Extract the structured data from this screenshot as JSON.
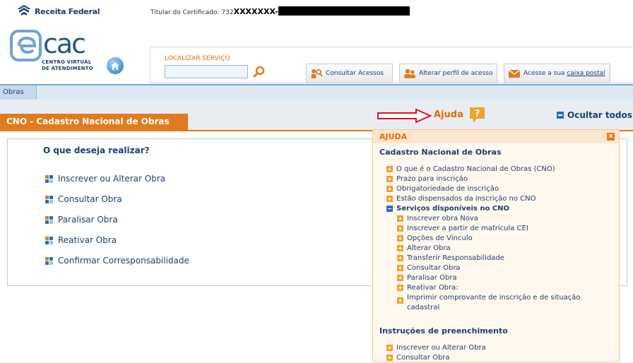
{
  "header": {
    "brand": "Receita Federal",
    "certificate_label": "Titular do Certificado: 732",
    "certificate_id": "XXXXXXX-",
    "logo_text": "cac",
    "logo_subtitle_1": "CENTRO VIRTUAL",
    "logo_subtitle_2": "DE ATENDIMENTO"
  },
  "search": {
    "label": "LOCALIZAR SERVIÇO",
    "value": ""
  },
  "toolbar": {
    "consultar_acessos": "Consultar Acessos",
    "alterar_perfil": "Alterar perfil de acesso",
    "caixa_prefix": "Acesse a sua ",
    "caixa_link": "caixa postal"
  },
  "nav": {
    "obras": "Obras"
  },
  "page": {
    "title": "CNO - Cadastro Nacional de Obras",
    "question": "O que deseja realizar?",
    "options": [
      "Inscrever ou Alterar Obra",
      "Consultar Obra",
      "Paralisar Obra",
      "Reativar Obra",
      "Confirmar Corresponsabilidade"
    ]
  },
  "help": {
    "link": "Ajuda",
    "hide_all": "Ocultar todos",
    "panel_title": "AJUDA",
    "close": "x",
    "section1": "Cadastro Nacional de Obras",
    "items": [
      "O que é o Cadastro Nacional de Obras (CNO)",
      "Prazo para inscrição",
      "Obrigatoriedade de inscrição",
      "Estão dispensados da inscrição no CNO"
    ],
    "expanded": "Serviços disponíveis no CNO",
    "subitems": [
      "Inscrever obra Nova",
      "Inscrever a partir de matrícula CEI",
      "Opções de Vínculo",
      "Alterar Obra",
      "Transferir Responsabilidade",
      "Consultar Obra",
      "Paralisar Obra",
      "Reativar Obra:",
      "Imprimir comprovante de inscrição e de situação cadastral"
    ],
    "section2": "Instruções de preenchimento",
    "items2": [
      "Inscrever ou Alterar Obra",
      "Consultar Obra"
    ]
  },
  "colors": {
    "accent_orange": "#e07b1f",
    "brand_blue": "#1c3f6e"
  }
}
